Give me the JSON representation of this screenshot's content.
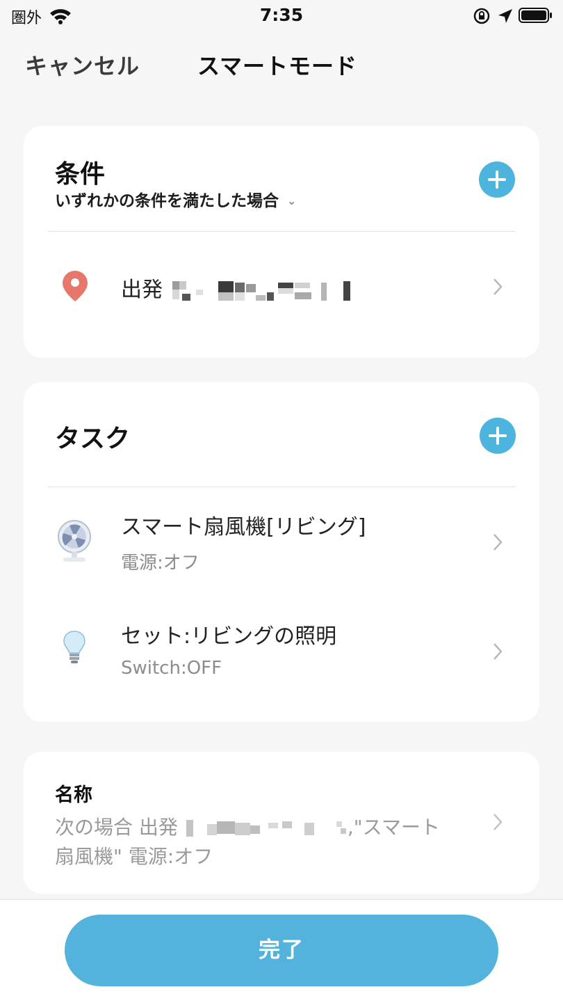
{
  "status_bar": {
    "carrier": "圏外",
    "time": "7:35"
  },
  "nav": {
    "cancel_label": "キャンセル",
    "title": "スマートモード"
  },
  "conditions": {
    "title": "条件",
    "match_mode": "いずれかの条件を満たした場合",
    "items": [
      {
        "icon": "location-pin-icon",
        "label": "出発"
      }
    ]
  },
  "tasks": {
    "title": "タスク",
    "items": [
      {
        "icon": "fan-icon",
        "title": "スマート扇風機[リビング]",
        "subtitle": "電源:オフ"
      },
      {
        "icon": "light-bulb-icon",
        "title": "セット:リビングの照明",
        "subtitle": "Switch:OFF"
      }
    ]
  },
  "name_section": {
    "label": "名称",
    "value_prefix": "次の場合 出発",
    "value_suffix": ",\"スマート",
    "value_line2": "扇風機\" 電源:オフ"
  },
  "footer": {
    "done_label": "完了"
  },
  "colors": {
    "accent": "#4db4de",
    "done_button": "#54b3dc",
    "pin": "#e8776b"
  }
}
